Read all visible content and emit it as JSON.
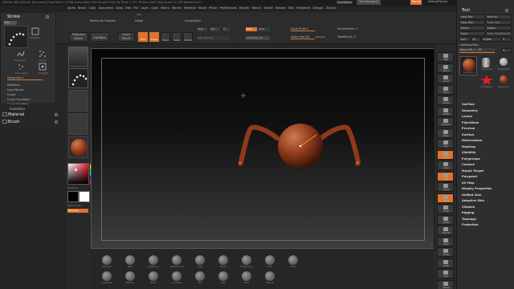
{
  "window": {
    "title": "ZBrush 4R8 [ZBrush Document]   Free Mem 4.47GB   Active Mem 304   Scratch Disk 48   Timer 1.107   ATime 0.842   PolyCount 0.13 KP   MeshCount 1",
    "quicksave": "QuickSave",
    "seethrough": "See-through 0",
    "menus": "Menus",
    "defaultscript": "DefaultZScript"
  },
  "menubar": [
    "Alpha",
    "Brush",
    "Color",
    "Document",
    "Draw",
    "Edit",
    "File",
    "Layer",
    "Light",
    "Macro",
    "Marker",
    "Material",
    "Movie",
    "Picker",
    "Preferences",
    "Render",
    "Stencil",
    "Stroke",
    "Texture",
    "Tool",
    "Transform",
    "Zplugin",
    "Zscript"
  ],
  "topshelf": {
    "projection_master": "Projection Master",
    "lightbox": "LightBox",
    "quick_sketch": "Quick Sketch",
    "edit": "Edit",
    "draw": "Draw",
    "move": "Move",
    "scale": "Scale",
    "rotate": "Rotate",
    "mrgb": "Mrgb",
    "rgb": "Rgb",
    "m": "M",
    "zadd": "Zadd",
    "zsub": "Zsub",
    "zcut": "Zcut",
    "rgb_intensity": "Rgb Intensity",
    "z_intensity": "Z Intensity 25",
    "focal_shift": "Focal Shift 0",
    "draw_size": "Draw Size 64",
    "dynamic": "Dynamic",
    "active_points": "ActivePoints: 2",
    "total_points": "TotalPoints: 2",
    "refresh_by_features": "Refresh By Features",
    "inflate": "Inflate",
    "group_visible": "GroupVisible",
    "size": "Size"
  },
  "stroke": {
    "title": "Stroke",
    "dots_label": "Dots",
    "items": [
      "DragRect",
      "FreeHand",
      "Spray",
      "Color Spray",
      "DragDot"
    ],
    "mouse_avg": "Mouse Avg 4",
    "modifiers": "Modifiers",
    "lazy_mouse": "Lazy Mouse",
    "curve": "Curve",
    "curve_functions": "Curve Functions",
    "curve_modifiers": "Curve Modifiers",
    "inventory": "Inventory"
  },
  "left_subpalettes": [
    "Material",
    "Brush"
  ],
  "left_tray": {
    "gradient": "Gradient",
    "switch_color": "SwitchColor",
    "alternate": "Alternate"
  },
  "right_shelf": [
    "BPR",
    "SPix 3",
    "Scroll",
    "Zoom",
    "Actual",
    "AAHalf",
    "Dynamic",
    "Persp",
    "Floor",
    "Local",
    "L.Sym",
    "Xyz",
    "Frame",
    "Move",
    "Scale",
    "Rotate",
    "Line Fill",
    "PolyF",
    "Transp",
    "Ghost",
    "Solo",
    "Xpose"
  ],
  "tool": {
    "title": "Tool",
    "load_tool": "Load Tool",
    "save_as": "Save As",
    "copy_tool": "Copy Tool",
    "paste_tool": "Paste Tool",
    "import": "Import",
    "export": "Export",
    "clone": "Clone",
    "make_polymesh": "Make PolyMesh3D",
    "goz": "GoZ",
    "all": "All",
    "visible": "Visible",
    "r": "R",
    "lightbox_tools": "Lightbox▸Tools",
    "sphere_label": "Sphere3D_1 . 48",
    "r2": "R",
    "thumbs": [
      "Sphere3D_1",
      "Cylinder3D",
      "PolyMesh3D",
      "SimpleBrush",
      "Sphere3D_1"
    ],
    "sections": [
      "SubTool",
      "Geometry",
      "Layers",
      "FiberMesh",
      "Preview",
      "Surface",
      "Deformation",
      "Masking",
      "Visibility",
      "Polygroups",
      "Contact",
      "Morph Target",
      "Polypaint",
      "UV Map",
      "Display Properties",
      "Unified Skin",
      "Adaptive Skin",
      "ZSketch",
      "Rigging",
      "Topology",
      "Projection"
    ]
  },
  "bottom_shelf": [
    "Standard",
    "Move",
    "ClayBuildup",
    "DamStandard",
    "Inflate",
    "hPolish",
    "TrimDynamic",
    "Pinch",
    "Flatten",
    "Snakehook",
    "ZModeler",
    "Slash3",
    "CurveTube",
    "IMM",
    "Alpha",
    "Stroke",
    "Material"
  ]
}
